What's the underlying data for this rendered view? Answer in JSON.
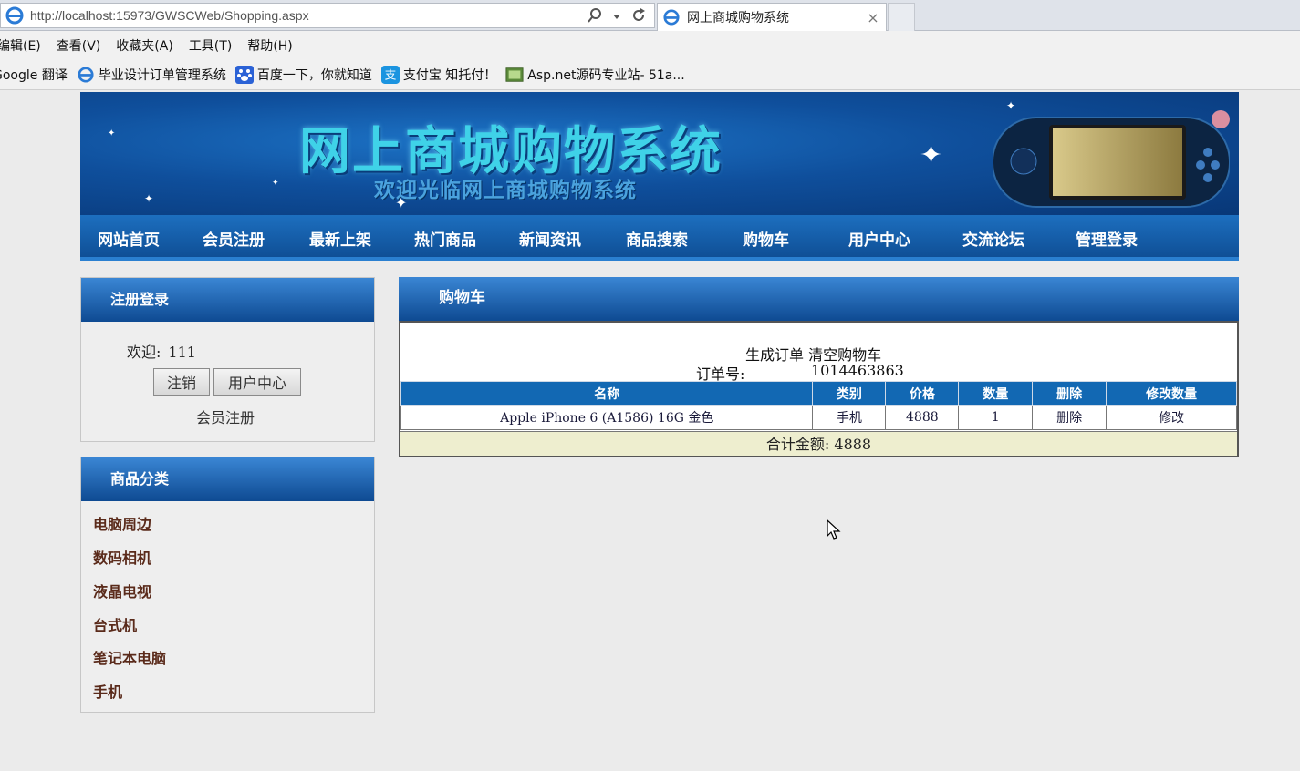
{
  "browser": {
    "url": "http://localhost:15973/GWSCWeb/Shopping.aspx",
    "tab_title": "网上商城购物系统",
    "tab_close": "×",
    "menu": [
      "编辑(E)",
      "查看(V)",
      "收藏夹(A)",
      "工具(T)",
      "帮助(H)"
    ],
    "favorites": [
      {
        "label": "Google 翻译",
        "icon": "google-icon"
      },
      {
        "label": "毕业设计订单管理系统",
        "icon": "ie-page-icon"
      },
      {
        "label": "百度一下，你就知道",
        "icon": "baidu-paw-icon"
      },
      {
        "label": "支付宝 知托付！",
        "icon": "alipay-icon"
      },
      {
        "label": "Asp.net源码专业站- 51a...",
        "icon": "asp-site-icon"
      }
    ]
  },
  "banner": {
    "title": "网上商城购物系统",
    "subtitle": "欢迎光临网上商城购物系统"
  },
  "nav": [
    "网站首页",
    "会员注册",
    "最新上架",
    "热门商品",
    "新闻资讯",
    "商品搜索",
    "购物车",
    "用户中心",
    "交流论坛",
    "管理登录"
  ],
  "login": {
    "heading": "注册登录",
    "welcome_label": "欢迎:",
    "username": "111",
    "logout_button": "注销",
    "user_center_button": "用户中心",
    "register_link": "会员注册"
  },
  "categories": {
    "heading": "商品分类",
    "items": [
      "电脑周边",
      "数码相机",
      "液晶电视",
      "台式机",
      "笔记本电脑",
      "手机"
    ]
  },
  "cart": {
    "heading": "购物车",
    "actions": "生成订单 清空购物车",
    "order_label": "订单号:",
    "order_number": "1014463863",
    "columns": [
      "名称",
      "类别",
      "价格",
      "数量",
      "删除",
      "修改数量"
    ],
    "rows": [
      {
        "name": "Apple iPhone 6 (A1586) 16G 金色",
        "category": "手机",
        "price": "4888",
        "qty": "1",
        "delete": "删除",
        "modify": "修改"
      }
    ],
    "total_label": "合计金额:",
    "total_value": "4888"
  }
}
